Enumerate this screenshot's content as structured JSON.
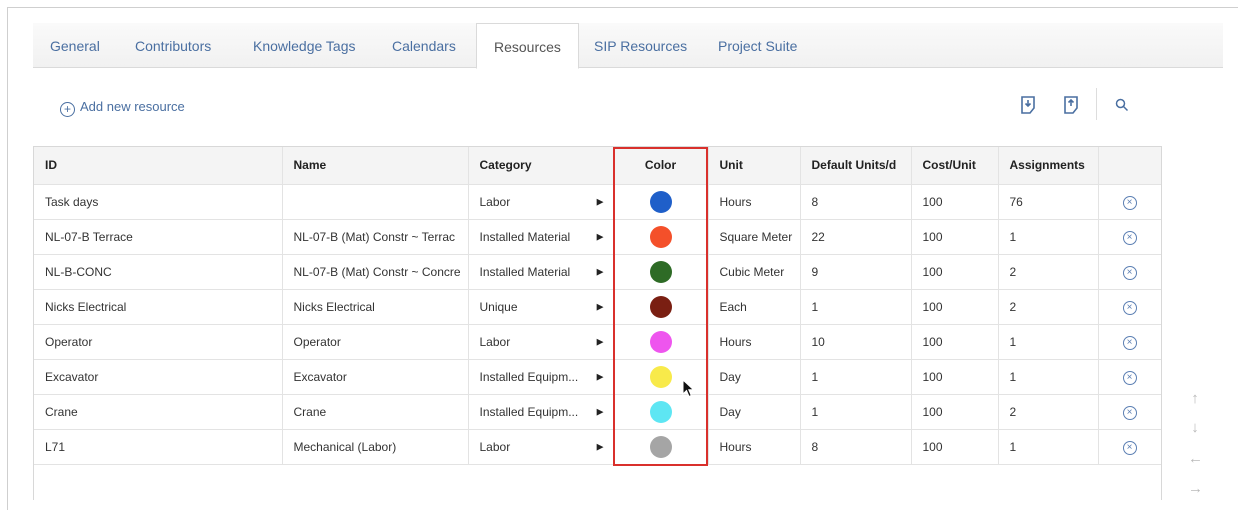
{
  "tabs": [
    {
      "label": "General"
    },
    {
      "label": "Contributors"
    },
    {
      "label": "Knowledge Tags"
    },
    {
      "label": "Calendars"
    },
    {
      "label": "Resources",
      "active": true
    },
    {
      "label": "SIP Resources"
    },
    {
      "label": "Project Suite"
    }
  ],
  "actions": {
    "add_new_resource": "Add new resource",
    "export_icon_1": "export-icon",
    "export_icon_2": "import-icon",
    "search_icon": "search-icon"
  },
  "table": {
    "headers": {
      "id": "ID",
      "name": "Name",
      "category": "Category",
      "color": "Color",
      "unit": "Unit",
      "default_units": "Default Units/d",
      "cost_unit": "Cost/Unit",
      "assignments": "Assignments"
    },
    "rows": [
      {
        "id": "Task days",
        "name": "",
        "category": "Labor",
        "color": "#1f5fc9",
        "unit": "Hours",
        "default_units": "8",
        "cost_unit": "100",
        "assignments": "76"
      },
      {
        "id": "NL-07-B Terrace",
        "name": "NL-07-B (Mat) Constr ~ Terrac",
        "category": "Installed Material",
        "color": "#f4502a",
        "unit": "Square Meter",
        "default_units": "22",
        "cost_unit": "100",
        "assignments": "1"
      },
      {
        "id": "NL-B-CONC",
        "name": "NL-07-B (Mat) Constr ~ Concre",
        "category": "Installed Material",
        "color": "#2e6b26",
        "unit": "Cubic Meter",
        "default_units": "9",
        "cost_unit": "100",
        "assignments": "2"
      },
      {
        "id": "Nicks Electrical",
        "name": "Nicks Electrical",
        "category": "Unique",
        "color": "#7a1f12",
        "unit": "Each",
        "default_units": "1",
        "cost_unit": "100",
        "assignments": "2"
      },
      {
        "id": "Operator",
        "name": "Operator",
        "category": "Labor",
        "color": "#ee55ee",
        "unit": "Hours",
        "default_units": "10",
        "cost_unit": "100",
        "assignments": "1"
      },
      {
        "id": "Excavator",
        "name": "Excavator",
        "category": "Installed Equipm...",
        "color": "#f8ea4a",
        "unit": "Day",
        "default_units": "1",
        "cost_unit": "100",
        "assignments": "1"
      },
      {
        "id": "Crane",
        "name": "Crane",
        "category": "Installed Equipm...",
        "color": "#5ee6f3",
        "unit": "Day",
        "default_units": "1",
        "cost_unit": "100",
        "assignments": "2"
      },
      {
        "id": "L71",
        "name": "Mechanical (Labor)",
        "category": "Labor",
        "color": "#a5a5a5",
        "unit": "Hours",
        "default_units": "8",
        "cost_unit": "100",
        "assignments": "1"
      }
    ]
  },
  "highlight_color": "#d9302c"
}
